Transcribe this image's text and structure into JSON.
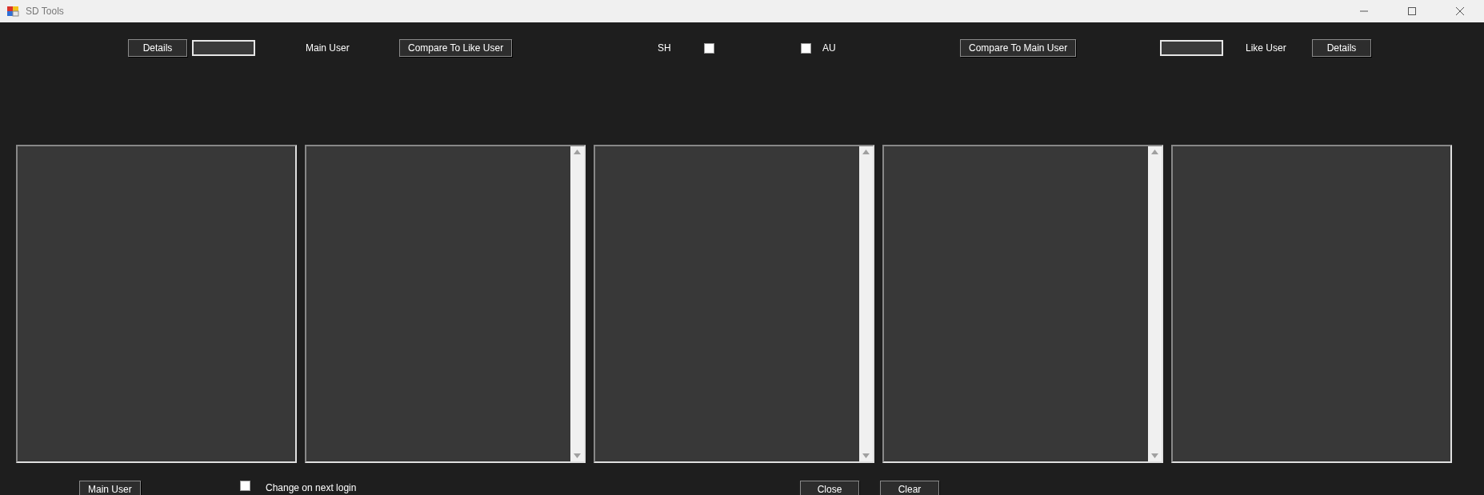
{
  "window": {
    "title": "SD Tools"
  },
  "top_bar": [
    {
      "kind": "button",
      "label": "Details"
    },
    {
      "kind": "textbox"
    },
    {
      "kind": "label",
      "text": "Main User"
    },
    {
      "kind": "button",
      "label": "Compare To Like User"
    },
    {
      "kind": "label",
      "text": "SH"
    },
    {
      "kind": "checkbox",
      "checked": false
    },
    {
      "kind": "checkbox",
      "checked": false
    },
    {
      "kind": "label",
      "text": "AU"
    },
    {
      "kind": "button",
      "label": "Compare To Main User"
    },
    {
      "kind": "textbox"
    },
    {
      "kind": "label",
      "text": "Like User"
    },
    {
      "kind": "button",
      "label": "Details"
    }
  ],
  "panels": [
    {
      "scrollbar": false
    },
    {
      "scrollbar": true
    },
    {
      "scrollbar": true
    },
    {
      "scrollbar": true
    },
    {
      "scrollbar": false
    }
  ],
  "bottom_bar": [
    {
      "kind": "button",
      "label": "Main User"
    },
    {
      "kind": "checkbox",
      "checked": false
    },
    {
      "kind": "label",
      "text": "Change on next login"
    },
    {
      "kind": "button",
      "label": "Close"
    },
    {
      "kind": "button",
      "label": "Clear"
    }
  ]
}
